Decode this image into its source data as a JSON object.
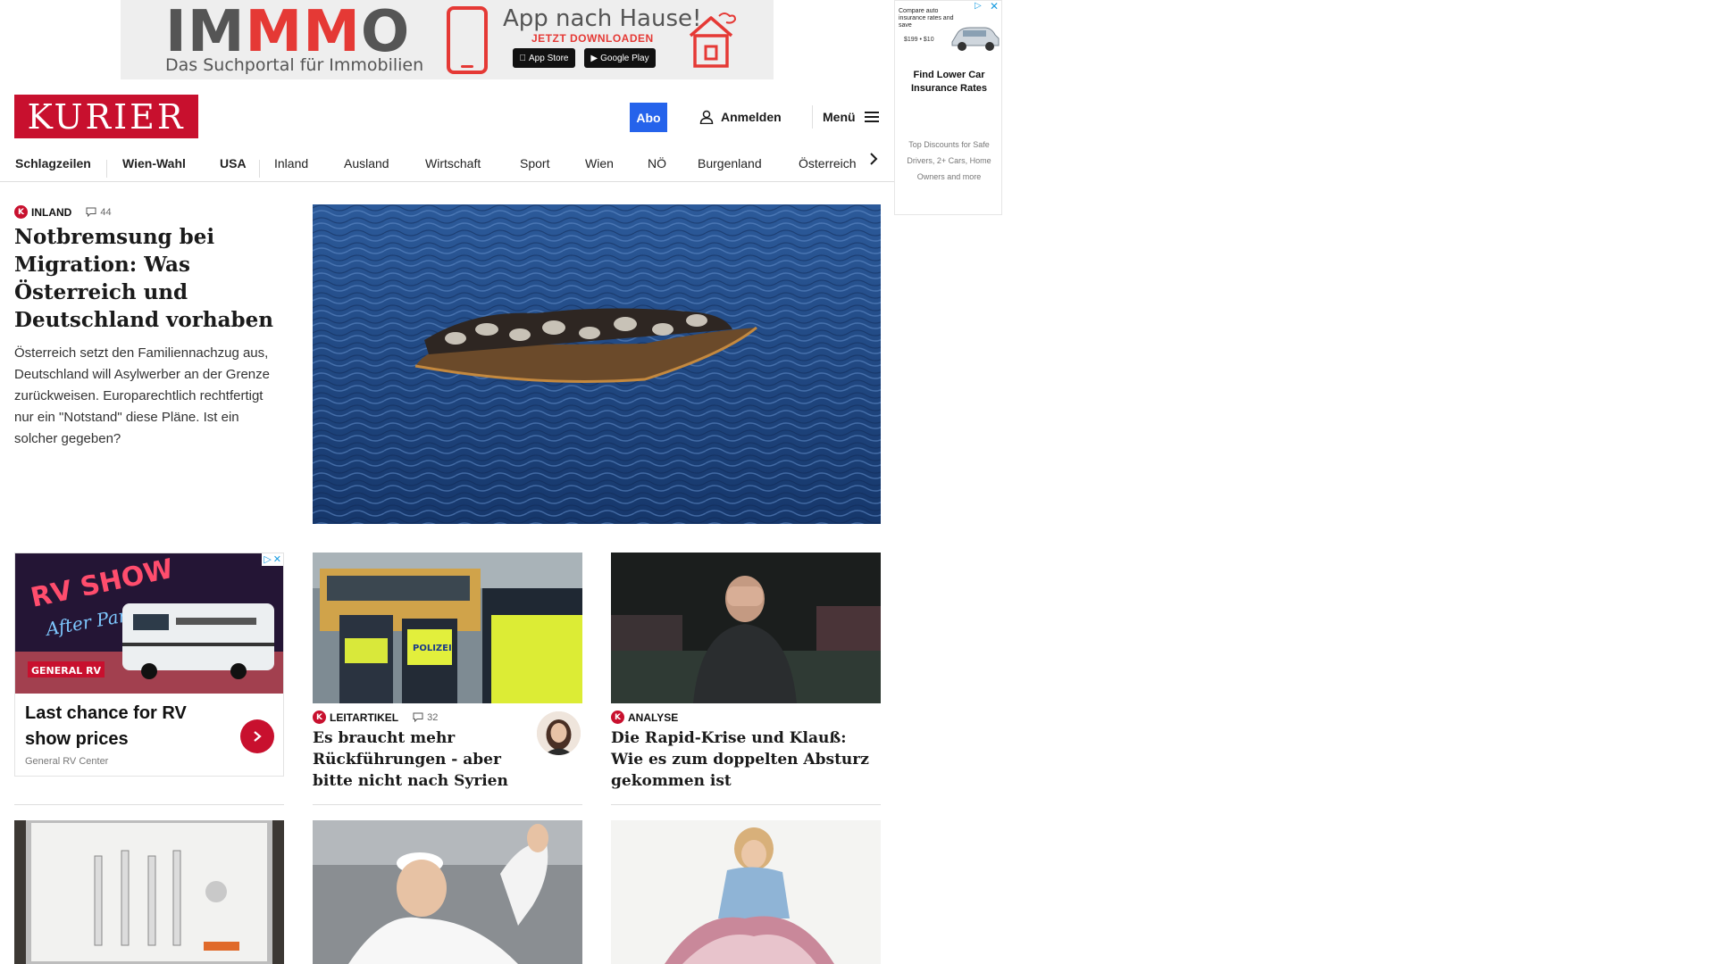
{
  "top_ad": {
    "brand_pre": "IM",
    "brand_mid": "MM",
    "brand_post": "O",
    "tagline": "Das Suchportal für Immobilien",
    "app_title": "App nach Hause!",
    "download_label": "JETZT DOWNLOADEN",
    "app_store_label": "App Store",
    "google_play_label": "Google Play"
  },
  "side_ad": {
    "teaser": "Compare auto insurance rates and save",
    "prices": "$199 • $10",
    "title": "Find Lower Car Insurance Rates",
    "description": "Top Discounts for Safe Drivers, 2+ Cars, Home Owners and more"
  },
  "header": {
    "logo": "KURIER",
    "abo_label": "Abo",
    "login_label": "Anmelden",
    "menu_label": "Menü"
  },
  "nav": {
    "items": [
      "Schlagzeilen",
      "Wien-Wahl",
      "USA",
      "Inland",
      "Ausland",
      "Wirtschaft",
      "Sport",
      "Wien",
      "NÖ",
      "Burgenland",
      "Österreich"
    ]
  },
  "hero": {
    "kicker": "INLAND",
    "comments": "44",
    "title": "Notbremsung bei Migration: Was Österreich und Deutschland vorhaben",
    "text": "Österreich setzt den Familiennachzug aus, Deutschland will Asylwerber an der Grenze zurückweisen. Europarechtlich rechtfertigt nur ein \"Notstand\" diese Pläne. Ist ein solcher gegeben?"
  },
  "sponsored": {
    "title": "Last chance for RV show prices",
    "source": "General RV Center",
    "image_text_1": "RV SHOW",
    "image_text_2": "After Party",
    "image_brand": "GENERAL RV"
  },
  "articles": [
    {
      "kicker": "LEITARTIKEL",
      "comments": "32",
      "title": "Es braucht mehr Rückführungen - aber bitte nicht nach Syrien",
      "image_text": "POLIZEI"
    },
    {
      "kicker": "ANALYSE",
      "title": "Die Rapid-Krise und Klauß: Wie es zum doppelten Absturz gekommen ist"
    }
  ],
  "badge_letter": "K"
}
